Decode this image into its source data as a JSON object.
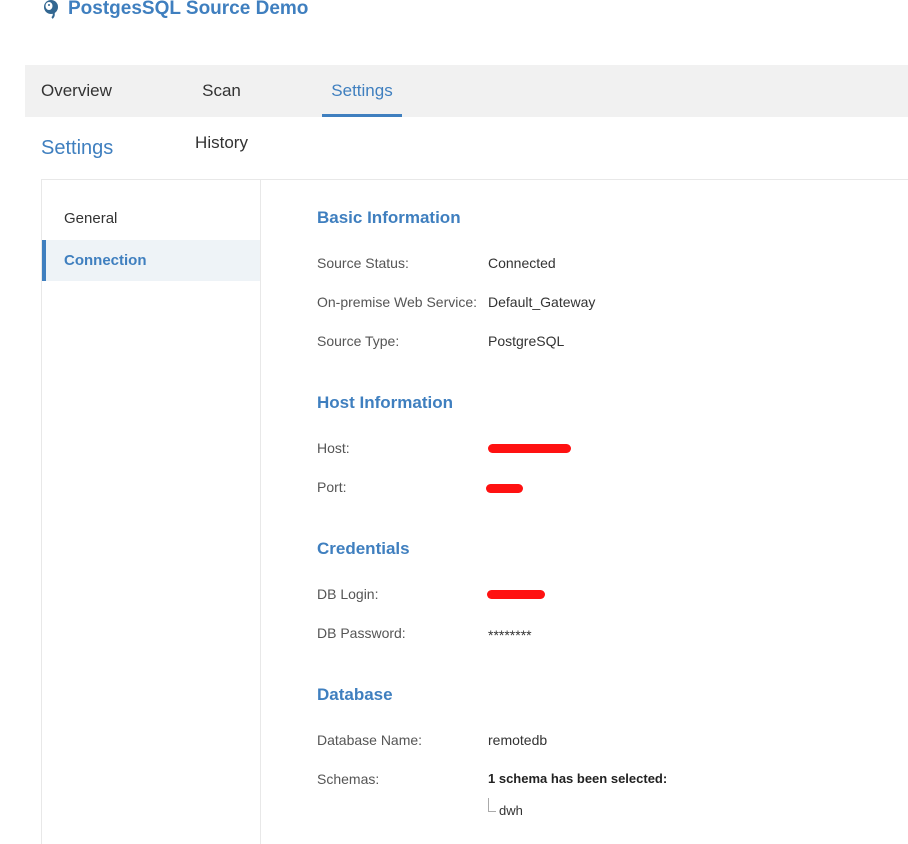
{
  "header": {
    "title": "PostgesSQL Source Demo",
    "icon": "postgres-elephant-icon"
  },
  "tabs": [
    {
      "label": "Overview",
      "active": false
    },
    {
      "label": "Scan History",
      "active": false
    },
    {
      "label": "Settings",
      "active": true
    }
  ],
  "page": {
    "title": "Settings"
  },
  "sidebar": {
    "items": [
      {
        "label": "General",
        "active": false
      },
      {
        "label": "Connection",
        "active": true
      }
    ]
  },
  "basic": {
    "title": "Basic Information",
    "status_label": "Source Status:",
    "status_value": "Connected",
    "service_label": "On-premise Web Service:",
    "service_value": "Default_Gateway",
    "type_label": "Source Type:",
    "type_value": "PostgreSQL"
  },
  "host": {
    "title": "Host Information",
    "host_label": "Host:",
    "port_label": "Port:"
  },
  "credentials": {
    "title": "Credentials",
    "login_label": "DB Login:",
    "password_label": "DB Password:",
    "password_value": "********"
  },
  "database": {
    "title": "Database",
    "name_label": "Database Name:",
    "name_value": "remotedb",
    "schemas_label": "Schemas:",
    "schemas_summary": "1 schema has been selected:",
    "schemas": [
      "dwh"
    ]
  },
  "colors": {
    "accent": "#3f7fbf",
    "redaction": "#ff1111",
    "tabbar_bg": "#f1f1f1"
  }
}
